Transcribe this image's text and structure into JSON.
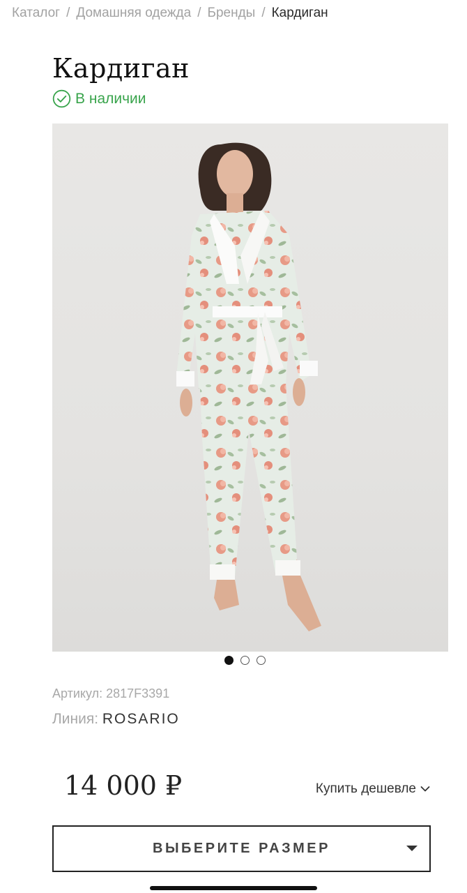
{
  "breadcrumb": {
    "items": [
      "Каталог",
      "Домашняя одежда",
      "Бренды"
    ],
    "current": "Кардиган",
    "separator": "/"
  },
  "product": {
    "title": "Кардиган",
    "stock_status": "В наличии",
    "stock_color": "#39a44c",
    "image_alt": "Model wearing floral pajama set with white satin trim",
    "gallery_dots": 3,
    "gallery_active_dot": 1,
    "sku_label": "Артикул:",
    "sku_value": "2817F3391",
    "line_label": "Линия:",
    "line_value": "ROSARIO",
    "price": "14 000 ₽",
    "cheaper_label": "Купить дешевле",
    "size_select_label": "ВЫБЕРИТЕ РАЗМЕР"
  },
  "icons": {
    "stock": "check-circle-icon",
    "cheaper": "chevron-down-icon",
    "size": "caret-down-icon"
  }
}
